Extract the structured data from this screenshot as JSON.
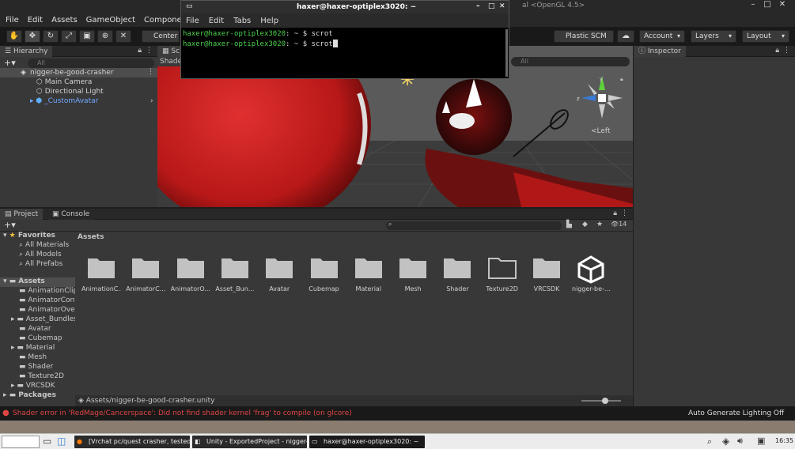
{
  "window": {
    "title_partial": "al <OpenGL 4.5>",
    "controls": [
      "–",
      "□",
      "✕"
    ]
  },
  "menu": [
    "File",
    "Edit",
    "Assets",
    "GameObject",
    "Compone"
  ],
  "toolbar": {
    "pivot_label": "Center",
    "plastic": "Plastic SCM",
    "account": "Account",
    "layers": "Layers",
    "layout": "Layout"
  },
  "hierarchy": {
    "tab": "Hierarchy",
    "search_placeholder": "All",
    "scene": "nigger-be-good-crasher",
    "items": [
      "Main Camera",
      "Directional Light",
      "_CustomAvatar"
    ]
  },
  "scene": {
    "tab": "Sc",
    "shading": "Shade",
    "search_placeholder": "All",
    "gizmo_label": "<Left",
    "axes": {
      "x": "x",
      "y": "y",
      "z": "z"
    }
  },
  "inspector": {
    "tab": "Inspector"
  },
  "project": {
    "tabs": [
      "Project",
      "Console"
    ],
    "count": "14",
    "favorites_label": "Favorites",
    "favorites": [
      "All Materials",
      "All Models",
      "All Prefabs"
    ],
    "assets_label": "Assets",
    "assets_tree": [
      "AnimationClip",
      "AnimatorCont",
      "AnimatorOver",
      "Asset_Bundles",
      "Avatar",
      "Cubemap",
      "Material",
      "Mesh",
      "Shader",
      "Texture2D",
      "VRCSDK"
    ],
    "packages_label": "Packages",
    "header": "Assets",
    "items": [
      "AnimationC...",
      "AnimatorC...",
      "AnimatorO...",
      "Asset_Bun...",
      "Avatar",
      "Cubemap",
      "Material",
      "Mesh",
      "Shader",
      "Texture2D",
      "VRCSDK",
      "nigger-be-..."
    ],
    "path": "Assets/nigger-be-good-crasher.unity"
  },
  "status": {
    "error": "Shader error in 'RedMage/Cancerspace': Did not find shader kernel 'frag' to compile (on glcore)",
    "right": "Auto Generate Lighting Off"
  },
  "terminal": {
    "title": "haxer@haxer-optiplex3020: ~",
    "menu": [
      "File",
      "Edit",
      "Tabs",
      "Help"
    ],
    "prompt": "haxer@haxer-optiplex3020",
    "path": ":",
    "suffix": " ~ $ ",
    "lines": [
      "scrot",
      "scrot"
    ]
  },
  "taskbar": {
    "tasks": [
      "[Vrchat pc/quest crasher, tested o...",
      "Unity - ExportedProject - nigger-b...",
      "haxer@haxer-optiplex3020: ~"
    ],
    "clock": "16:35"
  },
  "colors": {
    "error": "#e04545",
    "prompt_green": "#4ed24e",
    "accent_blue": "#3a7bd5"
  }
}
